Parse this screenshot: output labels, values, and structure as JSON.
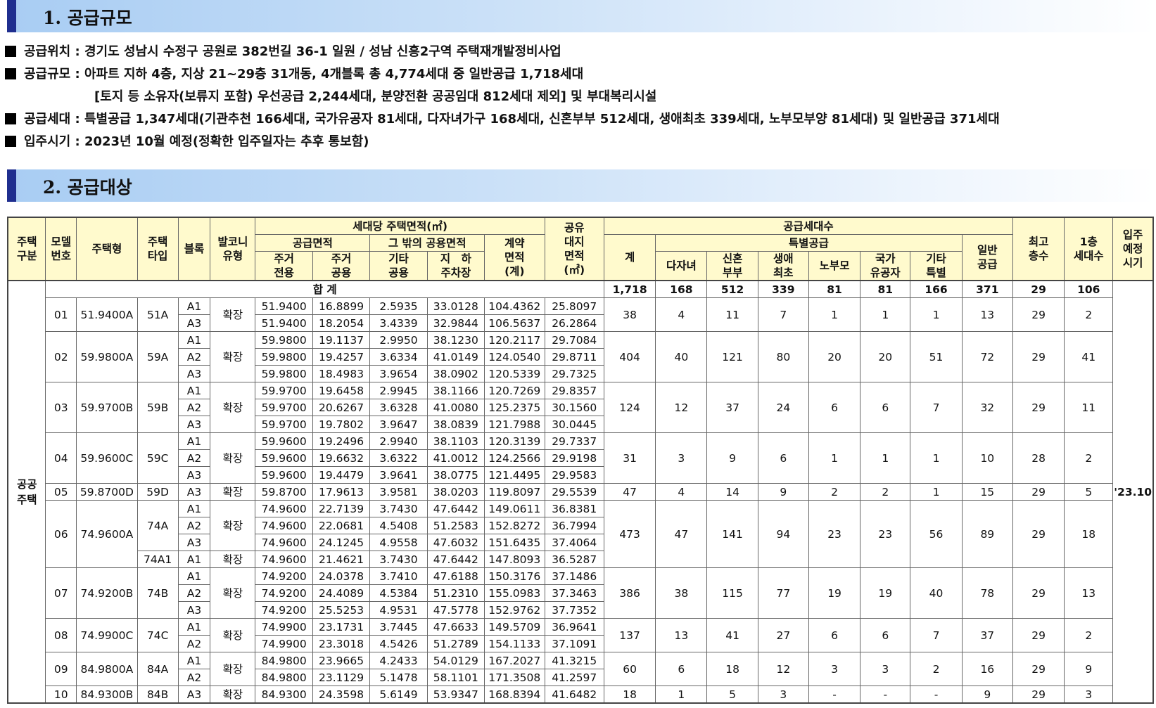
{
  "sections": {
    "s1_title": "1. 공급규모",
    "s2_title": "2. 공급대상"
  },
  "info": {
    "line1": "공급위치 : 경기도 성남시 수정구 공원로 382번길 36-1 일원 / 성남 신흥2구역 주택재개발정비사업",
    "line2": "공급규모 : 아파트 지하 4층, 지상 21~29층 31개동, 4개블록 총 4,774세대 중 일반공급 1,718세대",
    "line3": "[토지 등 소유자(보류지 포함) 우선공급 2,244세대, 분양전환 공공임대 812세대 제외] 및 부대복리시설",
    "line4": "공급세대 : 특별공급 1,347세대(기관추천 166세대, 국가유공자 81세대, 다자녀가구 168세대, 신혼부부 512세대, 생애최초 339세대, 노부모부양 81세대) 및 일반공급 371세대",
    "line5": "입주시기 : 2023년 10월 예정(정확한 입주일자는 추후 통보함)"
  },
  "headers": {
    "house_category": "주택\n구분",
    "model_no": "모델\n번호",
    "house_type": "주택형",
    "unit_type": "주택\n타입",
    "block": "블록",
    "balcony": "발코니\n유형",
    "area_group": "세대당 주택면적(㎡)",
    "supply_area": "공급면적",
    "other_common": "그 밖의 공용면적",
    "contract_area": "계약\n면적\n(계)",
    "private": "주거\n전용",
    "common": "주거\n공용",
    "other": "기타\n공용",
    "parking": "지　하\n주차장",
    "land_area": "공유\n대지\n면적\n(㎡)",
    "supply_units": "공급세대수",
    "total": "계",
    "special": "특별공급",
    "multi_child": "다자녀",
    "newlywed": "신혼\n부부",
    "first_life": "생애\n최초",
    "elderly": "노부모",
    "veteran": "국가\n유공자",
    "other_special": "기타\n특별",
    "general": "일반\n공급",
    "top_floor": "최고\n층수",
    "first_floor": "1층\n세대수",
    "move_in": "입주\n예정\n시기"
  },
  "total_row": {
    "label": "합 계",
    "total": "1,718",
    "multi_child": "168",
    "newlywed": "512",
    "first_life": "339",
    "elderly": "81",
    "veteran": "81",
    "other_special": "166",
    "general": "371",
    "top_floor": "29",
    "first_floor": "106"
  },
  "house_category": "공공\n주택",
  "move_in": "'23.10",
  "models": [
    {
      "no": "01",
      "type": "51.9400A",
      "total": "38",
      "multi_child": "4",
      "newlywed": "11",
      "first_life": "7",
      "elderly": "1",
      "veteran": "1",
      "other_special": "1",
      "general": "13",
      "top_floor": "29",
      "first_floor": "2",
      "groups": [
        {
          "unit": "51A",
          "rows": [
            {
              "block": "A1",
              "balcony": "확장",
              "private": "51.9400",
              "common": "16.8899",
              "other": "2.5935",
              "parking": "33.0128",
              "contract": "104.4362",
              "land": "25.8097"
            },
            {
              "block": "A3",
              "balcony": "",
              "private": "51.9400",
              "common": "18.2054",
              "other": "3.4339",
              "parking": "32.9844",
              "contract": "106.5637",
              "land": "26.2864"
            }
          ]
        }
      ]
    },
    {
      "no": "02",
      "type": "59.9800A",
      "total": "404",
      "multi_child": "40",
      "newlywed": "121",
      "first_life": "80",
      "elderly": "20",
      "veteran": "20",
      "other_special": "51",
      "general": "72",
      "top_floor": "29",
      "first_floor": "41",
      "groups": [
        {
          "unit": "59A",
          "rows": [
            {
              "block": "A1",
              "balcony": "확장",
              "private": "59.9800",
              "common": "19.1137",
              "other": "2.9950",
              "parking": "38.1230",
              "contract": "120.2117",
              "land": "29.7084"
            },
            {
              "block": "A2",
              "balcony": "",
              "private": "59.9800",
              "common": "19.4257",
              "other": "3.6334",
              "parking": "41.0149",
              "contract": "124.0540",
              "land": "29.8711"
            },
            {
              "block": "A3",
              "balcony": "",
              "private": "59.9800",
              "common": "18.4983",
              "other": "3.9654",
              "parking": "38.0902",
              "contract": "120.5339",
              "land": "29.7325"
            }
          ]
        }
      ]
    },
    {
      "no": "03",
      "type": "59.9700B",
      "total": "124",
      "multi_child": "12",
      "newlywed": "37",
      "first_life": "24",
      "elderly": "6",
      "veteran": "6",
      "other_special": "7",
      "general": "32",
      "top_floor": "29",
      "first_floor": "11",
      "groups": [
        {
          "unit": "59B",
          "rows": [
            {
              "block": "A1",
              "balcony": "확장",
              "private": "59.9700",
              "common": "19.6458",
              "other": "2.9945",
              "parking": "38.1166",
              "contract": "120.7269",
              "land": "29.8357"
            },
            {
              "block": "A2",
              "balcony": "",
              "private": "59.9700",
              "common": "20.6267",
              "other": "3.6328",
              "parking": "41.0080",
              "contract": "125.2375",
              "land": "30.1560"
            },
            {
              "block": "A3",
              "balcony": "",
              "private": "59.9700",
              "common": "19.7802",
              "other": "3.9647",
              "parking": "38.0839",
              "contract": "121.7988",
              "land": "30.0445"
            }
          ]
        }
      ]
    },
    {
      "no": "04",
      "type": "59.9600C",
      "total": "31",
      "multi_child": "3",
      "newlywed": "9",
      "first_life": "6",
      "elderly": "1",
      "veteran": "1",
      "other_special": "1",
      "general": "10",
      "top_floor": "28",
      "first_floor": "2",
      "groups": [
        {
          "unit": "59C",
          "rows": [
            {
              "block": "A1",
              "balcony": "확장",
              "private": "59.9600",
              "common": "19.2496",
              "other": "2.9940",
              "parking": "38.1103",
              "contract": "120.3139",
              "land": "29.7337"
            },
            {
              "block": "A2",
              "balcony": "",
              "private": "59.9600",
              "common": "19.6632",
              "other": "3.6322",
              "parking": "41.0012",
              "contract": "124.2566",
              "land": "29.9198"
            },
            {
              "block": "A3",
              "balcony": "",
              "private": "59.9600",
              "common": "19.4479",
              "other": "3.9641",
              "parking": "38.0775",
              "contract": "121.4495",
              "land": "29.9583"
            }
          ]
        }
      ]
    },
    {
      "no": "05",
      "type": "59.8700D",
      "total": "47",
      "multi_child": "4",
      "newlywed": "14",
      "first_life": "9",
      "elderly": "2",
      "veteran": "2",
      "other_special": "1",
      "general": "15",
      "top_floor": "29",
      "first_floor": "5",
      "groups": [
        {
          "unit": "59D",
          "rows": [
            {
              "block": "A3",
              "balcony": "확장",
              "private": "59.8700",
              "common": "17.9613",
              "other": "3.9581",
              "parking": "38.0203",
              "contract": "119.8097",
              "land": "29.5539"
            }
          ]
        }
      ]
    },
    {
      "no": "06",
      "type": "74.9600A",
      "total": "473",
      "multi_child": "47",
      "newlywed": "141",
      "first_life": "94",
      "elderly": "23",
      "veteran": "23",
      "other_special": "56",
      "general": "89",
      "top_floor": "29",
      "first_floor": "18",
      "groups": [
        {
          "unit": "74A",
          "rows": [
            {
              "block": "A1",
              "balcony": "확장",
              "private": "74.9600",
              "common": "22.7139",
              "other": "3.7430",
              "parking": "47.6442",
              "contract": "149.0611",
              "land": "36.8381"
            },
            {
              "block": "A2",
              "balcony": "",
              "private": "74.9600",
              "common": "22.0681",
              "other": "4.5408",
              "parking": "51.2583",
              "contract": "152.8272",
              "land": "36.7994"
            },
            {
              "block": "A3",
              "balcony": "",
              "private": "74.9600",
              "common": "24.1245",
              "other": "4.9558",
              "parking": "47.6032",
              "contract": "151.6435",
              "land": "37.4064"
            }
          ]
        },
        {
          "unit": "74A1",
          "rows": [
            {
              "block": "A1",
              "balcony": "확장",
              "private": "74.9600",
              "common": "21.4621",
              "other": "3.7430",
              "parking": "47.6442",
              "contract": "147.8093",
              "land": "36.5287"
            }
          ]
        }
      ]
    },
    {
      "no": "07",
      "type": "74.9200B",
      "total": "386",
      "multi_child": "38",
      "newlywed": "115",
      "first_life": "77",
      "elderly": "19",
      "veteran": "19",
      "other_special": "40",
      "general": "78",
      "top_floor": "29",
      "first_floor": "13",
      "groups": [
        {
          "unit": "74B",
          "rows": [
            {
              "block": "A1",
              "balcony": "확장",
              "private": "74.9200",
              "common": "24.0378",
              "other": "3.7410",
              "parking": "47.6188",
              "contract": "150.3176",
              "land": "37.1486"
            },
            {
              "block": "A2",
              "balcony": "",
              "private": "74.9200",
              "common": "24.4089",
              "other": "4.5384",
              "parking": "51.2310",
              "contract": "155.0983",
              "land": "37.3463"
            },
            {
              "block": "A3",
              "balcony": "",
              "private": "74.9200",
              "common": "25.5253",
              "other": "4.9531",
              "parking": "47.5778",
              "contract": "152.9762",
              "land": "37.7352"
            }
          ]
        }
      ]
    },
    {
      "no": "08",
      "type": "74.9900C",
      "total": "137",
      "multi_child": "13",
      "newlywed": "41",
      "first_life": "27",
      "elderly": "6",
      "veteran": "6",
      "other_special": "7",
      "general": "37",
      "top_floor": "29",
      "first_floor": "2",
      "groups": [
        {
          "unit": "74C",
          "rows": [
            {
              "block": "A1",
              "balcony": "확장",
              "private": "74.9900",
              "common": "23.1731",
              "other": "3.7445",
              "parking": "47.6633",
              "contract": "149.5709",
              "land": "36.9641"
            },
            {
              "block": "A2",
              "balcony": "",
              "private": "74.9900",
              "common": "23.3018",
              "other": "4.5426",
              "parking": "51.2789",
              "contract": "154.1133",
              "land": "37.1091"
            }
          ]
        }
      ]
    },
    {
      "no": "09",
      "type": "84.9800A",
      "total": "60",
      "multi_child": "6",
      "newlywed": "18",
      "first_life": "12",
      "elderly": "3",
      "veteran": "3",
      "other_special": "2",
      "general": "16",
      "top_floor": "29",
      "first_floor": "9",
      "groups": [
        {
          "unit": "84A",
          "rows": [
            {
              "block": "A1",
              "balcony": "확장",
              "private": "84.9800",
              "common": "23.9665",
              "other": "4.2433",
              "parking": "54.0129",
              "contract": "167.2027",
              "land": "41.3215"
            },
            {
              "block": "A2",
              "balcony": "",
              "private": "84.9800",
              "common": "23.1129",
              "other": "5.1478",
              "parking": "58.1101",
              "contract": "171.3508",
              "land": "41.2597"
            }
          ]
        }
      ]
    },
    {
      "no": "10",
      "type": "84.9300B",
      "total": "18",
      "multi_child": "1",
      "newlywed": "5",
      "first_life": "3",
      "elderly": "-",
      "veteran": "-",
      "other_special": "-",
      "general": "9",
      "top_floor": "29",
      "first_floor": "3",
      "groups": [
        {
          "unit": "84B",
          "rows": [
            {
              "block": "A3",
              "balcony": "확장",
              "private": "84.9300",
              "common": "24.3598",
              "other": "5.6149",
              "parking": "53.9347",
              "contract": "168.8394",
              "land": "41.6482"
            }
          ]
        }
      ]
    }
  ]
}
